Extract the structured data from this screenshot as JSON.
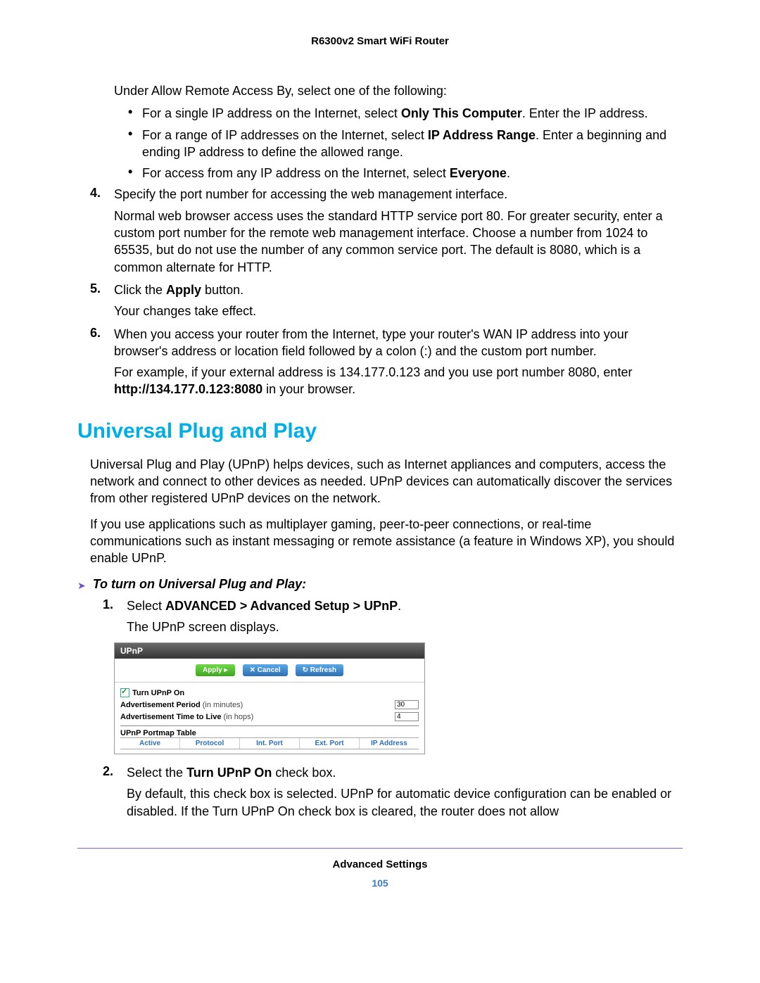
{
  "header": {
    "title": "R6300v2 Smart WiFi Router"
  },
  "intro": "Under Allow Remote Access By, select one of the following:",
  "bullets": {
    "b1a": "For a single IP address on the Internet, select ",
    "b1b": "Only This Computer",
    "b1c": ". Enter the IP address.",
    "b2a": "For a range of IP addresses on the Internet, select ",
    "b2b": "IP Address Range",
    "b2c": ". Enter a beginning and ending IP address to define the allowed range.",
    "b3a": "For access from any IP address on the Internet, select ",
    "b3b": "Everyone",
    "b3c": "."
  },
  "steps": {
    "s4num": "4.",
    "s4": "Specify the port number for accessing the web management interface.",
    "s4p": "Normal web browser access uses the standard HTTP service port 80. For greater security, enter a custom port number for the remote web management interface. Choose a number from 1024 to 65535, but do not use the number of any common service port. The default is 8080, which is a common alternate for HTTP.",
    "s5num": "5.",
    "s5a": "Click the ",
    "s5b": "Apply",
    "s5c": " button.",
    "s5p": "Your changes take effect.",
    "s6num": "6.",
    "s6": "When you access your router from the Internet, type your router's WAN IP address into your browser's address or location field followed by a colon (:) and the custom port number.",
    "s6pa": "For example, if your external address is 134.177.0.123 and you use port number 8080, enter ",
    "s6pb": "http://134.177.0.123:8080",
    "s6pc": " in your browser."
  },
  "section": {
    "heading": "Universal Plug and Play",
    "p1": "Universal Plug and Play (UPnP) helps devices, such as Internet appliances and computers, access the network and connect to other devices as needed. UPnP devices can automatically discover the services from other registered UPnP devices on the network.",
    "p2": "If you use applications such as multiplayer gaming, peer-to-peer connections, or real-time communications such as instant messaging or remote assistance (a feature in Windows XP), you should enable UPnP.",
    "arrow": "To turn on Universal Plug and Play:",
    "u1num": "1.",
    "u1a": "Select ",
    "u1b": "ADVANCED > Advanced Setup > UPnP",
    "u1c": ".",
    "u1p": "The UPnP screen displays.",
    "u2num": "2.",
    "u2a": "Select the ",
    "u2b": "Turn UPnP On",
    "u2c": " check box.",
    "u2p": "By default, this check box is selected. UPnP for automatic device configuration can be enabled or disabled. If the Turn UPnP On check box is cleared, the router does not allow"
  },
  "panel": {
    "title": "UPnP",
    "apply": "Apply ▸",
    "cancel": "✕ Cancel",
    "refresh": "↻ Refresh",
    "turnon": "Turn UPnP On",
    "adv_period_label": "Advertisement Period",
    "adv_period_unit": "(in minutes)",
    "adv_period_val": "30",
    "ttl_label": "Advertisement Time to Live",
    "ttl_unit": "(in hops)",
    "ttl_val": "4",
    "portmap_label": "UPnP Portmap Table",
    "cols": {
      "c1": "Active",
      "c2": "Protocol",
      "c3": "Int. Port",
      "c4": "Ext. Port",
      "c5": "IP Address"
    }
  },
  "footer": {
    "section": "Advanced Settings",
    "page": "105"
  }
}
